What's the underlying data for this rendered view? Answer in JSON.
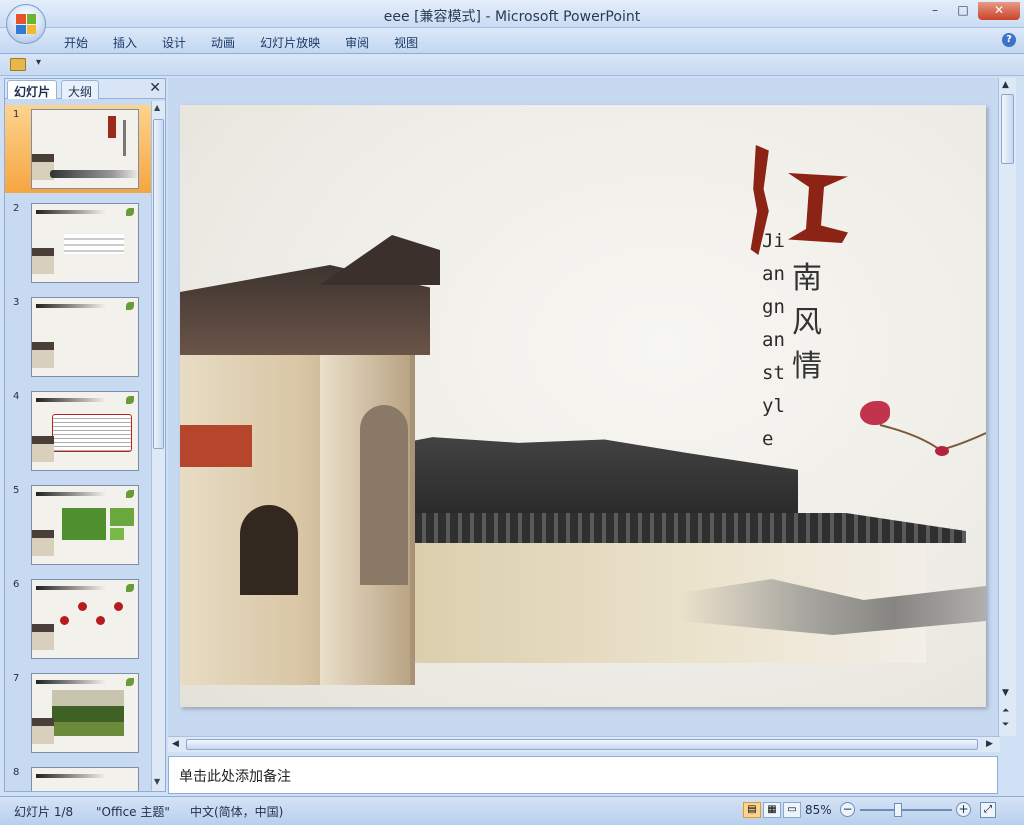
{
  "window": {
    "title": "eee [兼容模式] - Microsoft PowerPoint",
    "minimize": "–",
    "maximize": "□",
    "close": "✕"
  },
  "ribbon": {
    "tabs": [
      "开始",
      "插入",
      "设计",
      "动画",
      "幻灯片放映",
      "审阅",
      "视图"
    ],
    "help": "?"
  },
  "qat": {
    "dropdown": "▾"
  },
  "left_panel": {
    "tab_slides": "幻灯片",
    "tab_outline": "大纲",
    "close": "✕",
    "slides": [
      {
        "num": "1"
      },
      {
        "num": "2"
      },
      {
        "num": "3"
      },
      {
        "num": "4"
      },
      {
        "num": "5"
      },
      {
        "num": "6"
      },
      {
        "num": "7"
      },
      {
        "num": "8"
      }
    ]
  },
  "slide": {
    "english_title": "Jiangnan style",
    "chinese_title": "南风情"
  },
  "notes": {
    "placeholder": "单击此处添加备注"
  },
  "statusbar": {
    "slide_counter": "幻灯片 1/8",
    "theme": "\"Office 主题\"",
    "language": "中文(简体，中国)",
    "zoom": "85%",
    "zoom_level_percent": 85
  },
  "colors": {
    "accent_selected": "#f6a540",
    "ink_red": "#8c2416",
    "ribbon_bg": "#c3d7f1"
  }
}
